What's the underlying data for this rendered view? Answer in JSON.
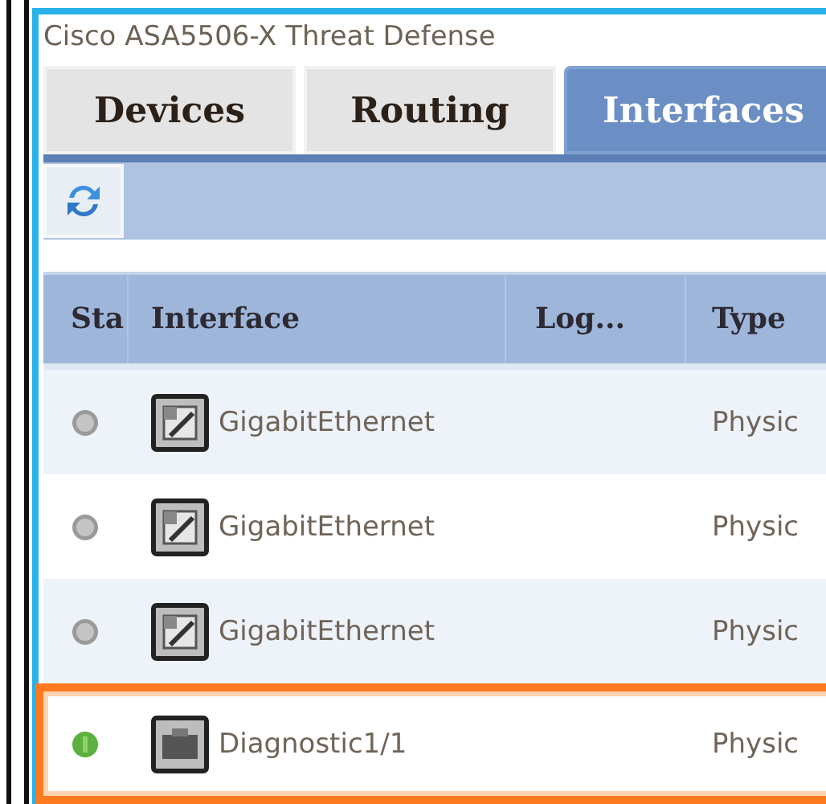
{
  "window": {
    "title": "Cisco ASA5506-X Threat Defense"
  },
  "tabs": [
    {
      "label": "Devices",
      "selected": false
    },
    {
      "label": "Routing",
      "selected": false
    },
    {
      "label": "Interfaces",
      "selected": true
    }
  ],
  "table": {
    "columns": [
      "Sta",
      "Interface",
      "Log...",
      "Type"
    ],
    "rows": [
      {
        "online": false,
        "kind": "ethernet",
        "interface": "GigabitEthernet",
        "type": "Physic",
        "highlighted": false
      },
      {
        "online": false,
        "kind": "ethernet",
        "interface": "GigabitEthernet",
        "type": "Physic",
        "highlighted": false
      },
      {
        "online": false,
        "kind": "ethernet",
        "interface": "GigabitEthernet",
        "type": "Physic",
        "highlighted": false
      },
      {
        "online": true,
        "kind": "diagnostic",
        "interface": "Diagnostic1/1",
        "type": "Physic",
        "highlighted": true
      }
    ]
  }
}
